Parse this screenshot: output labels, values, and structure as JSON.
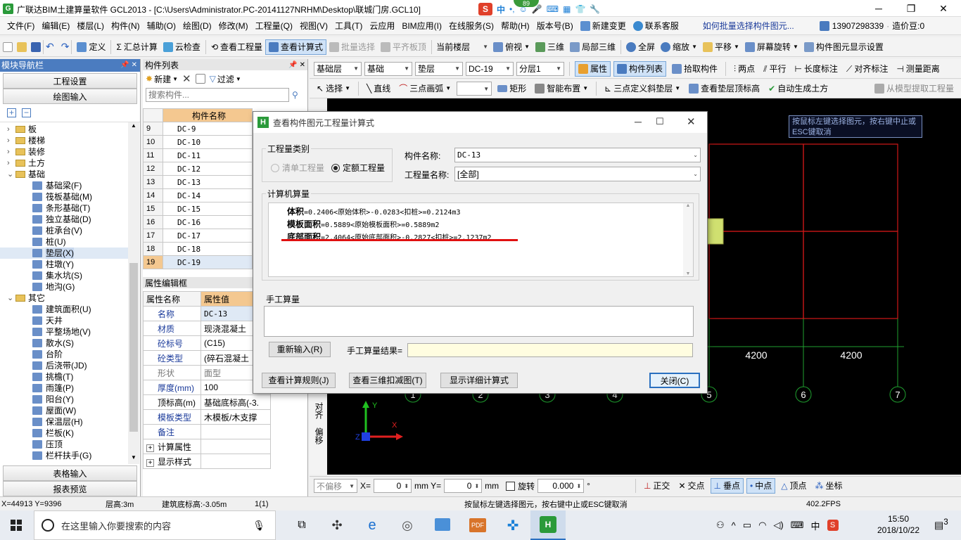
{
  "window": {
    "title": "广联达BIM土建算量软件 GCL2013 - [C:\\Users\\Administrator.PC-20141127NRHM\\Desktop\\联城门房.GCL10]",
    "minimize": "─",
    "restore": "❐",
    "close": "✕",
    "badge": "89"
  },
  "menu": {
    "items": [
      "文件(F)",
      "编辑(E)",
      "楼层(L)",
      "构件(N)",
      "辅助(O)",
      "绘图(D)",
      "修改(M)",
      "工程量(Q)",
      "视图(V)",
      "工具(T)",
      "云应用",
      "BIM应用(I)",
      "在线服务(S)",
      "帮助(H)",
      "版本号(B)"
    ],
    "new_change": "新建变更",
    "contact": "联系客服",
    "search_hint": "如何批量选择构件图元...",
    "phone": "13907298339",
    "beans": "造价豆:0"
  },
  "toolbar1": {
    "define": "定义",
    "sum": "汇总计算",
    "cloud_check": "云检查",
    "view_qty": "查看工程量",
    "view_formula": "查看计算式",
    "batch_select": "批量选择",
    "flat_roof": "平齐板顶",
    "current_floor": "当前楼层",
    "top_view": "俯视",
    "three_d": "三维",
    "local_3d": "局部三维",
    "full_screen": "全屏",
    "zoom": "缩放",
    "pan": "平移",
    "rotate_screen": "屏幕旋转",
    "show_setting": "构件图元显示设置"
  },
  "toolbar2": {
    "floor": "基础层",
    "type": "基础",
    "sub": "垫层",
    "comp": "DC-19",
    "layer": "分层1",
    "attr": "属性",
    "comp_list": "构件列表",
    "pick": "拾取构件",
    "two_point": "两点",
    "parallel": "平行",
    "length_mark": "长度标注",
    "align_mark": "对齐标注",
    "measure": "测量距离"
  },
  "toolbar3": {
    "select": "选择",
    "line": "直线",
    "arc": "三点画弧",
    "rect": "矩形",
    "smart": "智能布置",
    "slope": "三点定义斜垫层",
    "view_top": "查看垫层顶标高",
    "auto_earth": "自动生成土方",
    "extract": "从模型提取工程量"
  },
  "left_panel": {
    "title": "模块导航栏",
    "pin": "📌 ✕",
    "project_setup": "工程设置",
    "drawing_input": "绘图输入",
    "table_input": "表格输入",
    "report_preview": "报表预览",
    "tree": [
      {
        "level": 0,
        "type": "folder",
        "label": "板",
        "exp": "›"
      },
      {
        "level": 0,
        "type": "folder",
        "label": "楼梯",
        "exp": "›"
      },
      {
        "level": 0,
        "type": "folder",
        "label": "装修",
        "exp": "›"
      },
      {
        "level": 0,
        "type": "folder",
        "label": "土方",
        "exp": "›"
      },
      {
        "level": 0,
        "type": "folder",
        "label": "基础",
        "exp": "⌄"
      },
      {
        "level": 1,
        "type": "node",
        "label": "基础梁(F)"
      },
      {
        "level": 1,
        "type": "node",
        "label": "筏板基础(M)"
      },
      {
        "level": 1,
        "type": "node",
        "label": "条形基础(T)"
      },
      {
        "level": 1,
        "type": "node",
        "label": "独立基础(D)"
      },
      {
        "level": 1,
        "type": "node",
        "label": "桩承台(V)"
      },
      {
        "level": 1,
        "type": "node",
        "label": "桩(U)"
      },
      {
        "level": 1,
        "type": "node",
        "label": "垫层(X)",
        "selected": true
      },
      {
        "level": 1,
        "type": "node",
        "label": "柱墩(Y)"
      },
      {
        "level": 1,
        "type": "node",
        "label": "集水坑(S)"
      },
      {
        "level": 1,
        "type": "node",
        "label": "地沟(G)"
      },
      {
        "level": 0,
        "type": "folder",
        "label": "其它",
        "exp": "⌄"
      },
      {
        "level": 1,
        "type": "node",
        "label": "建筑面积(U)"
      },
      {
        "level": 1,
        "type": "node",
        "label": "天井"
      },
      {
        "level": 1,
        "type": "node",
        "label": "平整场地(V)"
      },
      {
        "level": 1,
        "type": "node",
        "label": "散水(S)"
      },
      {
        "level": 1,
        "type": "node",
        "label": "台阶"
      },
      {
        "level": 1,
        "type": "node",
        "label": "后浇带(JD)"
      },
      {
        "level": 1,
        "type": "node",
        "label": "挑檐(T)"
      },
      {
        "level": 1,
        "type": "node",
        "label": "雨篷(P)"
      },
      {
        "level": 1,
        "type": "node",
        "label": "阳台(Y)"
      },
      {
        "level": 1,
        "type": "node",
        "label": "屋面(W)"
      },
      {
        "level": 1,
        "type": "node",
        "label": "保温层(H)"
      },
      {
        "level": 1,
        "type": "node",
        "label": "栏板(K)"
      },
      {
        "level": 1,
        "type": "node",
        "label": "压顶"
      },
      {
        "level": 1,
        "type": "node",
        "label": "栏杆扶手(G)"
      }
    ]
  },
  "comp_list": {
    "title": "构件列表",
    "new": "新建",
    "filter": "过滤",
    "search_placeholder": "搜索构件...",
    "col_header": "构件名称",
    "rows": [
      {
        "n": "9",
        "name": "DC-9"
      },
      {
        "n": "10",
        "name": "DC-10"
      },
      {
        "n": "11",
        "name": "DC-11"
      },
      {
        "n": "12",
        "name": "DC-12"
      },
      {
        "n": "13",
        "name": "DC-13"
      },
      {
        "n": "14",
        "name": "DC-14"
      },
      {
        "n": "15",
        "name": "DC-15"
      },
      {
        "n": "16",
        "name": "DC-16"
      },
      {
        "n": "17",
        "name": "DC-17"
      },
      {
        "n": "18",
        "name": "DC-18"
      },
      {
        "n": "19",
        "name": "DC-19",
        "selected": true
      }
    ]
  },
  "prop_editor": {
    "title": "属性编辑框",
    "h_name": "属性名称",
    "h_value": "属性值",
    "rows": [
      {
        "k": "名称",
        "v": "DC-13",
        "style": "k"
      },
      {
        "k": "材质",
        "v": "现浇混凝土",
        "style": "k"
      },
      {
        "k": "砼标号",
        "v": "(C15)",
        "style": "k"
      },
      {
        "k": "砼类型",
        "v": "(碎石混凝土",
        "style": "k"
      },
      {
        "k": "形状",
        "v": "面型",
        "style": "kg"
      },
      {
        "k": "厚度(mm)",
        "v": "100",
        "style": "k"
      },
      {
        "k": "顶标高(m)",
        "v": "基础底标高(-3.",
        "style": ""
      },
      {
        "k": "模板类型",
        "v": "木模板/木支撑",
        "style": "k"
      },
      {
        "k": "备注",
        "v": "",
        "style": "k"
      },
      {
        "k": "计算属性",
        "v": "",
        "style": "",
        "exp": "+"
      },
      {
        "k": "显示样式",
        "v": "",
        "style": "",
        "exp": "+"
      }
    ]
  },
  "dialog": {
    "title": "查看构件图元工程量计算式",
    "qty_type_label": "工程量类别",
    "radio_bill": "清单工程量",
    "radio_quota": "定额工程量",
    "comp_name_label": "构件名称:",
    "comp_name_value": "DC-13",
    "qty_name_label": "工程量名称:",
    "qty_name_value": "[全部]",
    "computer_label": "计算机算量",
    "lines": [
      {
        "k": "体积",
        "v": "=0.2406<原始体积>-0.0283<扣桩>=0.2124m3"
      },
      {
        "k": "模板面积",
        "v": "=0.5889<原始模板面积>=0.5889m2"
      },
      {
        "k": "底部面积",
        "v": "=2.4064<原始底部面积>-0.2827<扣桩>=2.1237m2"
      }
    ],
    "manual_label": "手工算量",
    "reinput": "重新输入(R)",
    "manual_result": "手工算量结果=",
    "btn_rules": "查看计算规则(J)",
    "btn_3d": "查看三维扣减图(T)",
    "btn_detail": "显示详细计算式",
    "btn_close": "关闭(C)"
  },
  "canvas": {
    "hint": "按鼠标左键选择图元，按右键中止或ESC键取消",
    "dims": [
      "4200",
      "4200"
    ],
    "axes": [
      "1",
      "2",
      "3",
      "4",
      "5",
      "6",
      "7"
    ]
  },
  "side_tools": {
    "align": "对齐",
    "offset": "偏移"
  },
  "coord_bar": {
    "no_offset": "不偏移",
    "x_label": "X=",
    "x_val": "0",
    "y_label": "mm Y=",
    "y_val": "0",
    "mm": "mm",
    "rotate": "旋转",
    "angle": "0.000",
    "deg": "°",
    "ortho": "正交",
    "intersect": "交点",
    "perp": "垂点",
    "mid": "中点",
    "vertex": "顶点",
    "coord": "坐标"
  },
  "status": {
    "xy": "X=44913 Y=9396",
    "floor_h": "层高:3m",
    "base_elev": "建筑底标高:-3.05m",
    "count": "1(1)",
    "msg": "按鼠标左键选择图元，按右键中止或ESC键取消",
    "fps": "402.2FPS"
  },
  "taskbar": {
    "search": "在这里输入你要搜索的内容",
    "time": "15:50",
    "date": "2018/10/22",
    "ime": "中",
    "notif": "3"
  },
  "colors": {
    "accent": "#4b7cc0",
    "red_grid": "#d01818",
    "green_axis": "#20a030",
    "highlight_line": "#e01010"
  }
}
